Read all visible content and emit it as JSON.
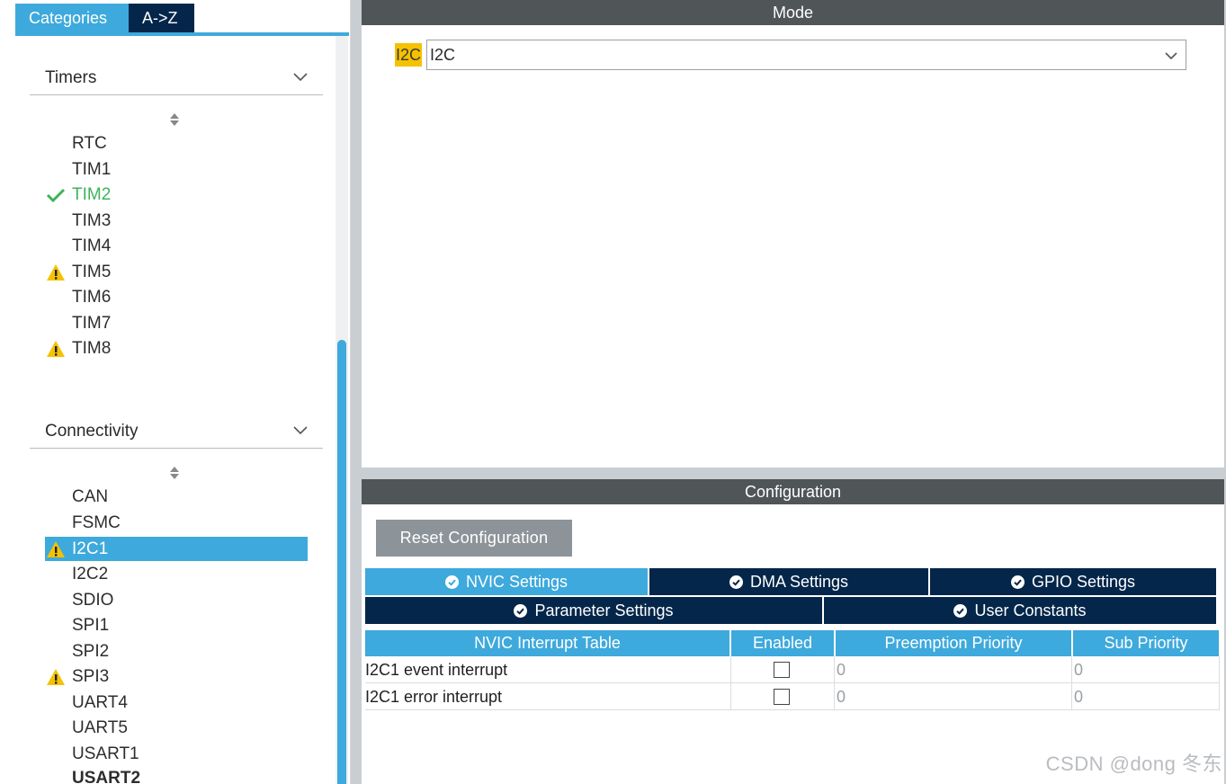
{
  "left": {
    "tabs": [
      {
        "label": "Categories"
      },
      {
        "label": "A->Z"
      }
    ],
    "timers": {
      "title": "Timers",
      "items": [
        {
          "label": "RTC",
          "status": "none"
        },
        {
          "label": "TIM1",
          "status": "none"
        },
        {
          "label": "TIM2",
          "status": "ok"
        },
        {
          "label": "TIM3",
          "status": "none"
        },
        {
          "label": "TIM4",
          "status": "none"
        },
        {
          "label": "TIM5",
          "status": "warning"
        },
        {
          "label": "TIM6",
          "status": "none"
        },
        {
          "label": "TIM7",
          "status": "none"
        },
        {
          "label": "TIM8",
          "status": "warning"
        }
      ]
    },
    "connectivity": {
      "title": "Connectivity",
      "items": [
        {
          "label": "CAN",
          "status": "none"
        },
        {
          "label": "FSMC",
          "status": "none"
        },
        {
          "label": "I2C1",
          "status": "warning",
          "selected": true
        },
        {
          "label": "I2C2",
          "status": "none"
        },
        {
          "label": "SDIO",
          "status": "none"
        },
        {
          "label": "SPI1",
          "status": "none"
        },
        {
          "label": "SPI2",
          "status": "none"
        },
        {
          "label": "SPI3",
          "status": "warning"
        },
        {
          "label": "UART4",
          "status": "none"
        },
        {
          "label": "UART5",
          "status": "none"
        },
        {
          "label": "USART1",
          "status": "none"
        },
        {
          "label": "USART2",
          "status": "none",
          "bold": true
        }
      ]
    }
  },
  "mode": {
    "title": "Mode",
    "field_label": "I2C",
    "select_value": "I2C"
  },
  "config": {
    "title": "Configuration",
    "reset_label": "Reset Configuration",
    "tabs_row1": [
      {
        "label": "NVIC Settings",
        "active": true
      },
      {
        "label": "DMA Settings",
        "active": false
      },
      {
        "label": "GPIO Settings",
        "active": false
      }
    ],
    "tabs_row2": [
      {
        "label": "Parameter Settings",
        "active": false
      },
      {
        "label": "User Constants",
        "active": false
      }
    ],
    "table": {
      "headers": [
        "NVIC Interrupt Table",
        "Enabled",
        "Preemption Priority",
        "Sub Priority"
      ],
      "rows": [
        {
          "name": "I2C1 event interrupt",
          "enabled": false,
          "preemption": "0",
          "sub": "0"
        },
        {
          "name": "I2C1 error interrupt",
          "enabled": false,
          "preemption": "0",
          "sub": "0"
        }
      ]
    }
  },
  "watermark": "CSDN @dong 冬东",
  "colors": {
    "accent": "#3ea9dc",
    "navy": "#04264a",
    "ok": "#3cb45a",
    "warning": "#f5c200",
    "panel_title": "#505558"
  }
}
